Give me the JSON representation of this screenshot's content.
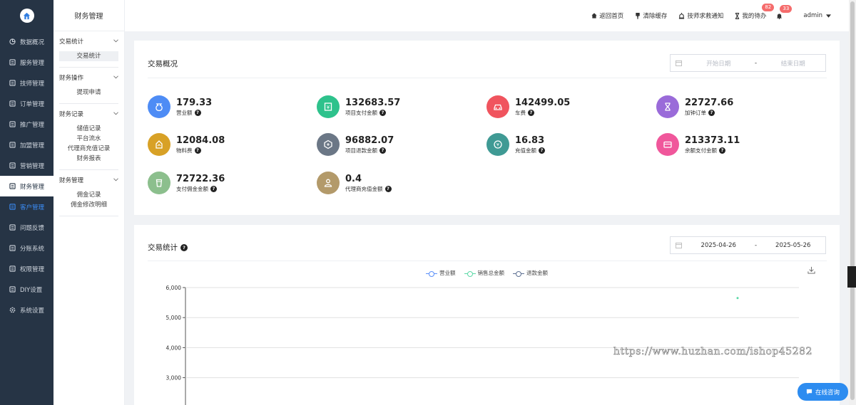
{
  "nav": {
    "items": [
      {
        "label": "数据概况",
        "icon": "pie-chart-icon"
      },
      {
        "label": "服务管理",
        "icon": "service-icon"
      },
      {
        "label": "技师管理",
        "icon": "headset-icon"
      },
      {
        "label": "订单管理",
        "icon": "order-icon"
      },
      {
        "label": "推广管理",
        "icon": "promotion-icon"
      },
      {
        "label": "加盟管理",
        "icon": "join-icon"
      },
      {
        "label": "营销管理",
        "icon": "marketing-icon"
      },
      {
        "label": "财务管理",
        "icon": "finance-icon"
      },
      {
        "label": "客户管理",
        "icon": "customer-icon"
      },
      {
        "label": "问题反馈",
        "icon": "feedback-icon"
      },
      {
        "label": "分账系统",
        "icon": "split-icon"
      },
      {
        "label": "权限管理",
        "icon": "permission-icon"
      },
      {
        "label": "DIY设置",
        "icon": "diy-icon"
      },
      {
        "label": "系统设置",
        "icon": "gear-icon"
      }
    ]
  },
  "sub": {
    "title": "财务管理",
    "groups": [
      {
        "title": "交易统计",
        "items": [
          "交易统计"
        ]
      },
      {
        "title": "财务操作",
        "items": [
          "提现申请"
        ]
      },
      {
        "title": "财务记录",
        "items": [
          "储值记录",
          "平台流水",
          "代理商充值记录",
          "财务报表"
        ]
      },
      {
        "title": "财务管理",
        "items": [
          "佣金记录",
          "佣金修改明细"
        ]
      }
    ]
  },
  "topbar": {
    "home": "返回首页",
    "clear_cache": "清除缓存",
    "help": "技师求救通知",
    "todo": "我的待办",
    "todo_badge": "82",
    "bell_badge": "33",
    "user": "admin"
  },
  "overview": {
    "title": "交易概况",
    "start_placeholder": "开始日期",
    "sep": "-",
    "end_placeholder": "结束日期",
    "stats": [
      {
        "value": "179.33",
        "label": "营业额",
        "color": "#4e8cf5",
        "icon": "money-bag-icon"
      },
      {
        "value": "132683.57",
        "label": "项目支付金额",
        "color": "#2ec28c",
        "icon": "yuan-card-icon"
      },
      {
        "value": "142499.05",
        "label": "车费",
        "color": "#f0545e",
        "icon": "car-icon"
      },
      {
        "value": "22727.66",
        "label": "加钟订单",
        "color": "#9a6bd9",
        "icon": "hourglass-icon"
      },
      {
        "value": "12084.08",
        "label": "物料费",
        "color": "#d8a126",
        "icon": "material-icon"
      },
      {
        "value": "96882.07",
        "label": "项目退款金额",
        "color": "#6b7786",
        "icon": "refund-icon"
      },
      {
        "value": "16.83",
        "label": "充值金额",
        "color": "#3f9a94",
        "icon": "yuan-coin-icon"
      },
      {
        "value": "213373.11",
        "label": "余额支付金额",
        "color": "#f0579b",
        "icon": "wallet-icon"
      },
      {
        "value": "72722.36",
        "label": "支付佣金金额",
        "color": "#8cbf8d",
        "icon": "cup-icon"
      },
      {
        "value": "0.4",
        "label": "代理商充值金额",
        "color": "#b39a6a",
        "icon": "agent-icon"
      }
    ]
  },
  "stats_section": {
    "title": "交易统计",
    "start_date": "2025-04-26",
    "sep": "-",
    "end_date": "2025-05-26"
  },
  "chart_data": {
    "type": "line",
    "title": "",
    "xlabel": "",
    "ylabel": "",
    "legend": [
      "营业额",
      "销售总金额",
      "退款金额"
    ],
    "legend_colors": [
      "#5b8ff9",
      "#5ad8a6",
      "#5d7092"
    ],
    "legend_position": "top-center",
    "y_ticks": [
      "6,000",
      "5,000",
      "4,000",
      "3,000"
    ],
    "ylim_visible": [
      3000,
      6000
    ],
    "grid": true,
    "series": [
      {
        "name": "销售总金额",
        "points": [
          {
            "y": 5650
          }
        ]
      }
    ]
  },
  "watermark": "https://www.huzhan.com/ishop45282",
  "chat": {
    "label": "在线咨询"
  }
}
